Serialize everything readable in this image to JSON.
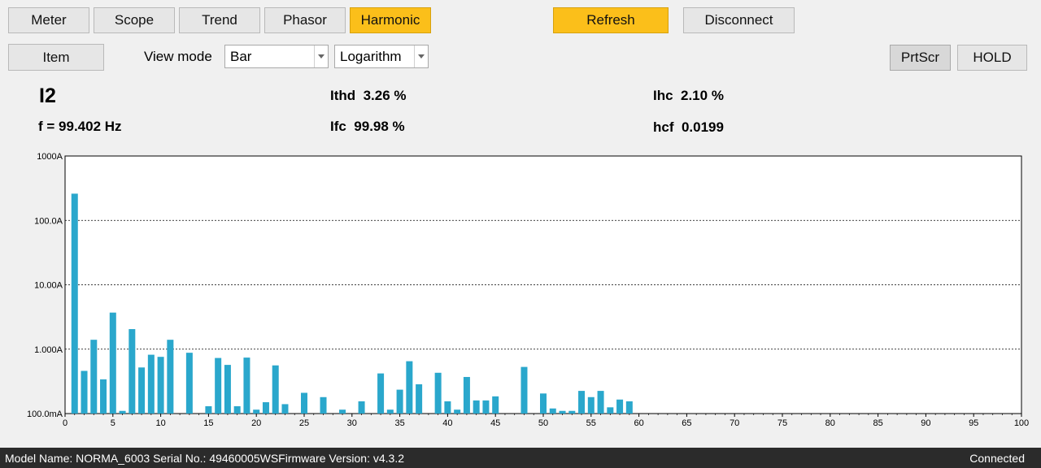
{
  "nav": {
    "meter": "Meter",
    "scope": "Scope",
    "trend": "Trend",
    "phasor": "Phasor",
    "harmonic": "Harmonic"
  },
  "actions": {
    "refresh": "Refresh",
    "disconnect": "Disconnect"
  },
  "toolbar": {
    "item": "Item",
    "view_mode_label": "View mode",
    "view_mode_value": "Bar",
    "scale_value": "Logarithm",
    "prtscr": "PrtScr",
    "hold": "HOLD"
  },
  "readout": {
    "channel": "I2",
    "frequency": "f = 99.402 Hz",
    "ithd": "Ithd  3.26 %",
    "ifc": "Ifc  99.98 %",
    "ihc": "Ihc  2.10 %",
    "hcf": "hcf  0.0199"
  },
  "colors": {
    "accent": "#fbbf1a",
    "bar": "#2aa7cc",
    "statusbar": "#2b2b2b"
  },
  "chart_data": {
    "type": "bar",
    "scale": "log",
    "ylim": [
      0.1,
      1000
    ],
    "y_ticks": [
      "1000A",
      "100.0A",
      "10.00A",
      "1.000A",
      "100.0mA"
    ],
    "x_ticks": [
      "0",
      "5",
      "10",
      "15",
      "20",
      "25",
      "30",
      "35",
      "40",
      "45",
      "50",
      "55",
      "60",
      "65",
      "70",
      "75",
      "80",
      "85",
      "90",
      "95",
      "100"
    ],
    "xlim": [
      0,
      100
    ],
    "grid": true,
    "x": [
      1,
      2,
      3,
      4,
      5,
      6,
      7,
      8,
      9,
      10,
      11,
      13,
      15,
      16,
      17,
      18,
      19,
      20,
      21,
      22,
      23,
      25,
      27,
      29,
      31,
      33,
      34,
      35,
      36,
      37,
      39,
      40,
      41,
      42,
      43,
      44,
      45,
      48,
      50,
      51,
      52,
      53,
      54,
      55,
      56,
      57,
      58,
      59
    ],
    "values": [
      260,
      0.46,
      1.4,
      0.34,
      3.7,
      0.11,
      2.05,
      0.52,
      0.82,
      0.76,
      1.4,
      0.88,
      0.13,
      0.73,
      0.57,
      0.13,
      0.74,
      0.115,
      0.15,
      0.56,
      0.14,
      0.21,
      0.18,
      0.115,
      0.155,
      0.42,
      0.115,
      0.235,
      0.65,
      0.285,
      0.43,
      0.155,
      0.115,
      0.37,
      0.16,
      0.16,
      0.185,
      0.53,
      0.205,
      0.12,
      0.11,
      0.11,
      0.225,
      0.18,
      0.225,
      0.125,
      0.165,
      0.155
    ]
  },
  "status": {
    "device_info": "Model Name:  NORMA_6003 Serial No.:  49460005WSFirmware Version:  v4.3.2",
    "connection": "Connected"
  }
}
